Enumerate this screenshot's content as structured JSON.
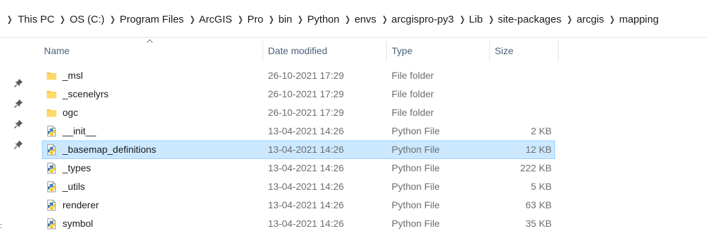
{
  "breadcrumb": {
    "segments": [
      "This PC",
      "OS (C:)",
      "Program Files",
      "ArcGIS",
      "Pro",
      "bin",
      "Python",
      "envs",
      "arcgispro-py3",
      "Lib",
      "site-packages",
      "arcgis",
      "mapping"
    ]
  },
  "columns": {
    "name": "Name",
    "date_modified": "Date modified",
    "type": "Type",
    "size": "Size"
  },
  "files": [
    {
      "name": "_msl",
      "date": "26-10-2021 17:29",
      "type": "File folder",
      "size": "",
      "icon": "folder-icon",
      "selected": false
    },
    {
      "name": "_scenelyrs",
      "date": "26-10-2021 17:29",
      "type": "File folder",
      "size": "",
      "icon": "folder-icon",
      "selected": false
    },
    {
      "name": "ogc",
      "date": "26-10-2021 17:29",
      "type": "File folder",
      "size": "",
      "icon": "folder-icon",
      "selected": false
    },
    {
      "name": "__init__",
      "date": "13-04-2021 14:26",
      "type": "Python File",
      "size": "2 KB",
      "icon": "python-file-icon",
      "selected": false
    },
    {
      "name": "_basemap_definitions",
      "date": "13-04-2021 14:26",
      "type": "Python File",
      "size": "12 KB",
      "icon": "python-file-icon",
      "selected": true
    },
    {
      "name": "_types",
      "date": "13-04-2021 14:26",
      "type": "Python File",
      "size": "222 KB",
      "icon": "python-file-icon",
      "selected": false
    },
    {
      "name": "_utils",
      "date": "13-04-2021 14:26",
      "type": "Python File",
      "size": "5 KB",
      "icon": "python-file-icon",
      "selected": false
    },
    {
      "name": "renderer",
      "date": "13-04-2021 14:26",
      "type": "Python File",
      "size": "63 KB",
      "icon": "python-file-icon",
      "selected": false
    },
    {
      "name": "symbol",
      "date": "13-04-2021 14:26",
      "type": "Python File",
      "size": "35 KB",
      "icon": "python-file-icon",
      "selected": false
    }
  ],
  "colors": {
    "selection_bg": "#cce8ff",
    "selection_border": "#99d1ff",
    "header_text": "#4c607a",
    "folder": "#f8c94a"
  }
}
